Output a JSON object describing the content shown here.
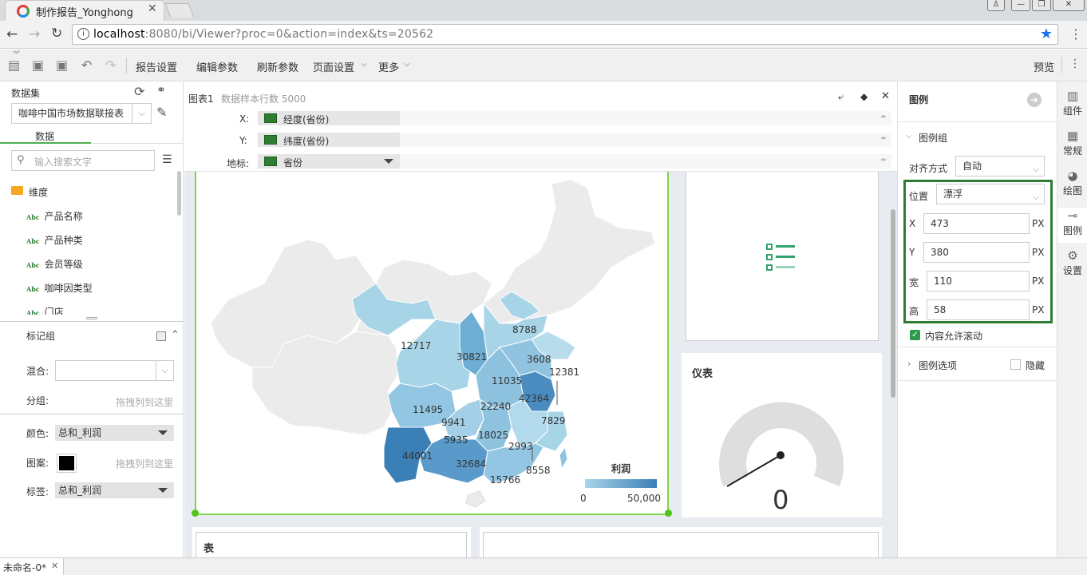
{
  "browser": {
    "tab_title": "制作报告_Yonghong",
    "url_host": "localhost",
    "url_rest": ":8080/bi/Viewer?proc=0&action=index&ts=20562"
  },
  "toolbar": {
    "report_settings": "报告设置",
    "edit_params": "编辑参数",
    "refresh_params": "刷新参数",
    "page_settings": "页面设置",
    "more": "更多",
    "preview": "预览"
  },
  "left": {
    "dataset_label": "数据集",
    "dataset_value": "咖啡中国市场数据联接表",
    "tab_data": "数据",
    "search_placeholder": "输入搜索文字",
    "dimension_folder": "维度",
    "fields": [
      "产品名称",
      "产品种类",
      "会员等级",
      "咖啡因类型",
      "门店"
    ],
    "abc": "Abc",
    "mark_group": "标记组",
    "mix_label": "混合:",
    "group_label": "分组:",
    "drag_hint": "拖拽列到这里",
    "color_label": "颜色:",
    "color_value": "总和_利润",
    "pattern_label": "图案:",
    "label_label": "标签:",
    "label_value": "总和_利润"
  },
  "chart": {
    "name": "图表1",
    "sample_rows": "数据样本行数 5000",
    "x_label": "X:",
    "x_value": "经度(省份)",
    "y_label": "Y:",
    "y_value": "纬度(省份)",
    "geo_label": "地标:",
    "geo_value": "省份",
    "legend_title": "利润",
    "legend_min": "0",
    "legend_max": "50,000",
    "province_labels": [
      "12717",
      "30821",
      "8788",
      "3608",
      "12381",
      "11035",
      "42364",
      "11495",
      "22240",
      "9941",
      "7829",
      "5935",
      "18025",
      "2993",
      "44001",
      "32684",
      "8558",
      "15766"
    ]
  },
  "gauge": {
    "title": "仪表",
    "value": "0"
  },
  "table": {
    "title": "表"
  },
  "right": {
    "legend_header": "图例",
    "legend_group": "图例组",
    "align_label": "对齐方式",
    "align_value": "自动",
    "position_label": "位置",
    "position_value": "漂浮",
    "x_label": "X",
    "x_value": "473",
    "y_label": "Y",
    "y_value": "380",
    "w_label": "宽",
    "w_value": "110",
    "h_label": "高",
    "h_value": "58",
    "unit": "PX",
    "scroll_label": "内容允许滚动",
    "legend_options": "图例选项",
    "hide_label": "隐藏"
  },
  "vtabs": {
    "components": "组件",
    "general": "常规",
    "drawing": "绘图",
    "legend": "图例",
    "settings": "设置"
  },
  "status": {
    "doc_tab": "未命名-0*"
  },
  "colors": {
    "accent_green": "#2e7d32",
    "selection_green": "#6ccc3a",
    "map_light": "#a8d4e8",
    "map_dark": "#3a7fb5",
    "map_gray": "#ebebeb"
  }
}
